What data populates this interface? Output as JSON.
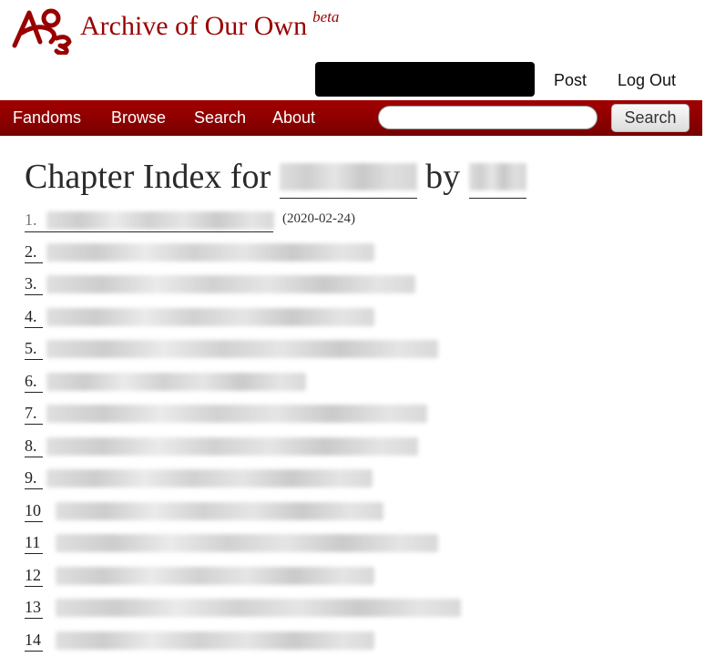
{
  "header": {
    "site_title": "Archive of Our Own",
    "beta_label": "beta",
    "post_link": "Post",
    "logout_link": "Log Out"
  },
  "nav": {
    "items": [
      "Fandoms",
      "Browse",
      "Search",
      "About"
    ],
    "search_button": "Search",
    "search_placeholder": ""
  },
  "page": {
    "heading_prefix": "Chapter Index for",
    "heading_by": "by"
  },
  "chapters": [
    {
      "number": "1.",
      "date": "(2020-02-24)"
    },
    {
      "number": "2."
    },
    {
      "number": "3."
    },
    {
      "number": "4."
    },
    {
      "number": "5."
    },
    {
      "number": "6."
    },
    {
      "number": "7."
    },
    {
      "number": "8."
    },
    {
      "number": "9."
    },
    {
      "number": "10"
    },
    {
      "number": "11"
    },
    {
      "number": "12"
    },
    {
      "number": "13"
    },
    {
      "number": "14"
    }
  ],
  "colors": {
    "brand": "#990000",
    "nav_background": "#8b0000",
    "user_box": "#000000"
  }
}
